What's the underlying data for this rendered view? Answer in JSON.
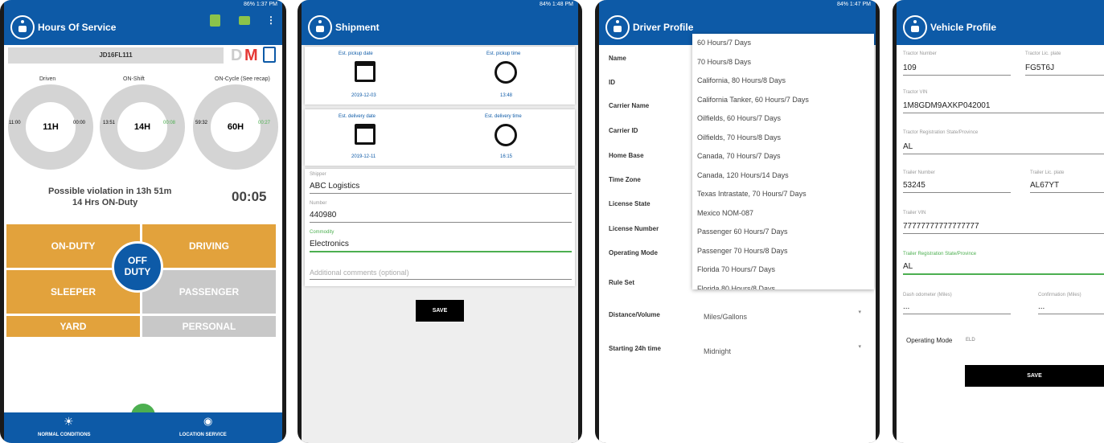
{
  "hos": {
    "status_bar": "86% 1:37 PM",
    "title": "Hours Of Service",
    "vehicle_id": "JD16FL111",
    "dm_d": "D",
    "dm_m": "M",
    "gauges": [
      {
        "label": "Driven",
        "left_val": "11:00",
        "center": "11H",
        "right_val": "00:00"
      },
      {
        "label": "ON-Shift",
        "left_val": "13:51",
        "center": "14H",
        "right_val": "00:08"
      },
      {
        "label": "ON-Cycle (See recap)",
        "left_val": "59:32",
        "center": "60H",
        "right_val": "00:27"
      }
    ],
    "violation_line1": "Possible violation in 13h 51m",
    "violation_line2": "14 Hrs ON-Duty",
    "timer": "00:05",
    "status_buttons": {
      "on_duty": "ON-DUTY",
      "driving": "DRIVING",
      "off": "OFF",
      "duty": "DUTY",
      "sleeper": "SLEEPER",
      "passenger": "PASSENGER",
      "yard": "YARD",
      "personal": "PERSONAL"
    },
    "nav": {
      "normal": "NORMAL CONDITIONS",
      "location": "LOCATION SERVICE"
    }
  },
  "shipment": {
    "status_bar": "84% 1:48 PM",
    "title": "Shipment",
    "pickup_date_label": "Est. pickup date",
    "pickup_time_label": "Est. pickup time",
    "pickup_date": "2019-12-03",
    "pickup_time": "13:48",
    "delivery_date_label": "Est. delivery date",
    "delivery_time_label": "Est. delivery time",
    "delivery_date": "2019-12-11",
    "delivery_time": "16:15",
    "shipper_label": "Shipper",
    "shipper": "ABC Logistics",
    "number_label": "Number",
    "number": "440980",
    "commodity_label": "Commodity",
    "commodity": "Electronics",
    "comments_placeholder": "Additional comments (optional)",
    "save": "SAVE"
  },
  "driver": {
    "status_bar": "84% 1:47 PM",
    "title": "Driver Profile",
    "labels": [
      "Name",
      "ID",
      "Carrier Name",
      "Carrier ID",
      "Home Base",
      "Time Zone",
      "License State",
      "License Number",
      "Operating Mode",
      "Rule Set",
      "Distance/Volume",
      "Starting 24h time"
    ],
    "distance_value": "Miles/Gallons",
    "start_time_value": "Midnight",
    "rule_options": [
      "60 Hours/7 Days",
      "70 Hours/8 Days",
      "California, 80 Hours/8 Days",
      "California Tanker, 60 Hours/7 Days",
      "Oilfields, 60 Hours/7 Days",
      "Oilfields, 70 Hours/8 Days",
      "Canada, 70 Hours/7 Days",
      "Canada, 120 Hours/14 Days",
      "Texas Intrastate, 70 Hours/7 Days",
      "Mexico NOM-087",
      "Passenger 60 Hours/7 Days",
      "Passenger 70 Hours/8 Days",
      "Florida 70 Hours/7 Days",
      "Florida 80 Hours/8 Days"
    ]
  },
  "vehicle": {
    "title": "Vehicle Profile",
    "tractor_number_label": "Tractor Number",
    "tractor_number": "109",
    "tractor_plate_label": "Tractor Lic. plate",
    "tractor_plate": "FG5T6J",
    "tractor_vin_label": "Tractor VIN",
    "tractor_vin": "1M8GDM9AXKP042001",
    "tractor_reg_label": "Tractor Registration State/Province",
    "tractor_reg": "AL",
    "trailer_number_label": "Trailer Number",
    "trailer_number": "53245",
    "trailer_plate_label": "Trailer Lic. plate",
    "trailer_plate": "AL67YT",
    "trailer_vin_label": "Trailer VIN",
    "trailer_vin": "77777777777777777",
    "trailer_reg_label": "Trailer Registration State/Province",
    "trailer_reg": "AL",
    "dash_label": "Dash odometer (Miles)",
    "dash_value": "...",
    "confirm_label": "Confirmation (Miles)",
    "confirm_value": "...",
    "op_mode_label": "Operating Mode",
    "op_mode_value": "ELD",
    "save": "SAVE"
  },
  "colors": {
    "primary": "#0d5aa7",
    "orange": "#e2a23c",
    "grey": "#c8c8c8",
    "green": "#4caf50",
    "red": "#e53935"
  }
}
